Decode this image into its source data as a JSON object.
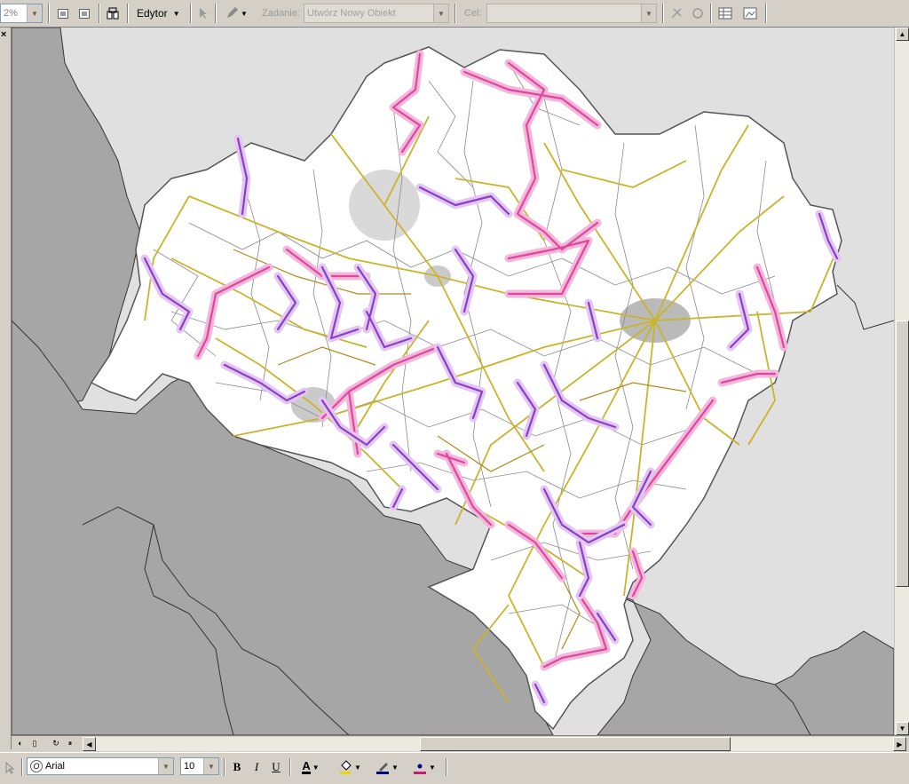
{
  "toolbar": {
    "zoom_value": "2%",
    "editor_label": "Edytor",
    "task_label": "Zadanie:",
    "task_value": "Utwórz Nowy Obiekt",
    "target_label": "Cel:",
    "target_value": ""
  },
  "drawing_toolbar": {
    "font_name": "Arial",
    "font_size": "10",
    "bold_label": "B",
    "italic_label": "I",
    "underline_label": "U",
    "font_color_label": "A"
  },
  "map": {
    "background_color": "#e0e0e0",
    "neighbor_color": "#a6a6a6",
    "region_color": "#ffffff",
    "road_color": "#c9b42a",
    "pink_route_color": "#e0479a",
    "purple_route_color": "#8a3fc8"
  }
}
